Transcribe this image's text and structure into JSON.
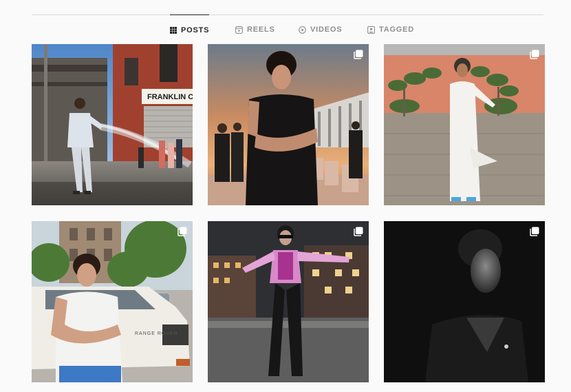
{
  "profile_tabs": [
    {
      "label": "POSTS",
      "icon": "grid-icon",
      "active": true
    },
    {
      "label": "REELS",
      "icon": "reels-icon",
      "active": false
    },
    {
      "label": "VIDEOS",
      "icon": "play-circle-icon",
      "active": false
    },
    {
      "label": "TAGGED",
      "icon": "tag-person-icon",
      "active": false
    }
  ],
  "posts": [
    {
      "description": "Man in light suit standing in city street beside spraying fire hydrant water",
      "multi": false,
      "sign_text": "FRANKLIN CI"
    },
    {
      "description": "Man in black t-shirt with arms crossed at sunset, camera crew behind",
      "multi": true
    },
    {
      "description": "Man in white robe and headscarf on cobblestone courtyard with topiary trees",
      "multi": true
    },
    {
      "description": "Man in white t-shirt with arms crossed leaning on white vintage SUV",
      "multi": true,
      "vehicle_badge": "RANGE ROVER"
    },
    {
      "description": "Man in pink jacket and sunglasses dancing in night city street",
      "multi": true
    },
    {
      "description": "Black and white portrait of man in dark coat",
      "multi": true
    }
  ],
  "colors": {
    "active_tab": "#262626",
    "inactive_tab": "#8e8e8e",
    "divider": "#dbdbdb",
    "background": "#fafafa"
  }
}
